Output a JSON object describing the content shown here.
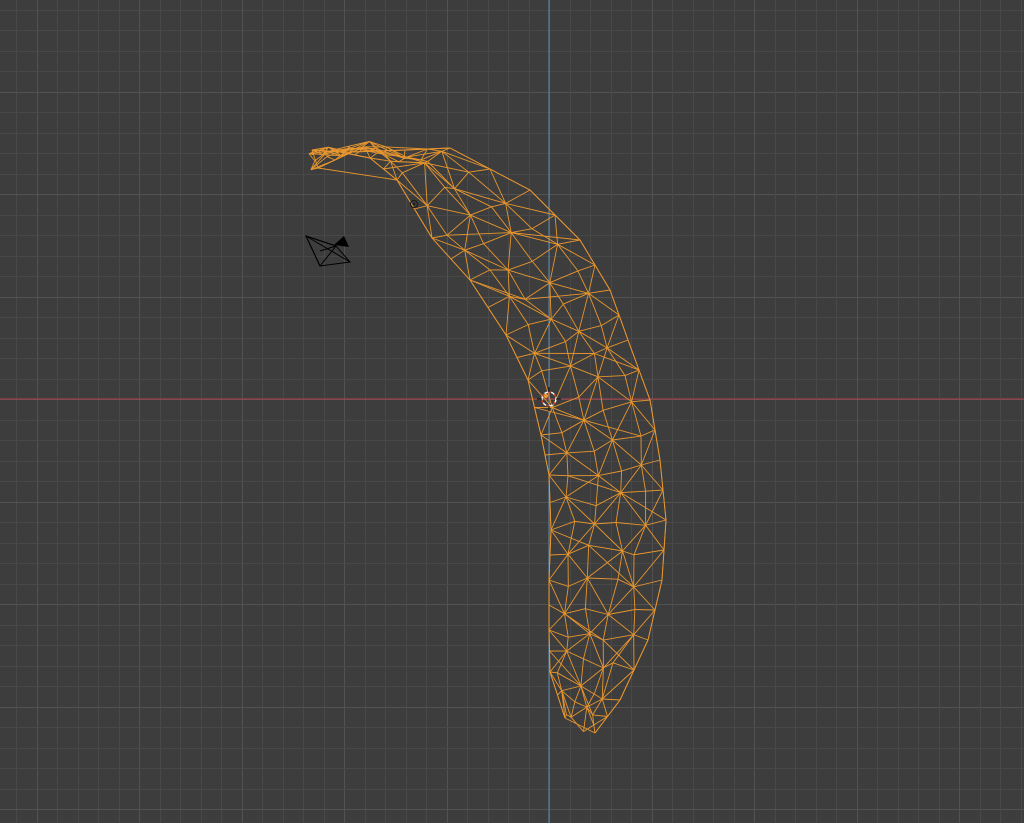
{
  "viewport": {
    "mode": "wireframe",
    "view": "orthographic"
  },
  "colors": {
    "background": "#3d3d3d",
    "grid_minor": "#484848",
    "grid_major": "#525252",
    "axis_x": "#b2404f",
    "axis_y": "#5a8ab0",
    "wire_selected": "#e8962e",
    "camera": "#000000",
    "light": "#1a1a1a",
    "origin": "#e8962e",
    "cursor_ring": "#ffffff",
    "cursor_dash": "#d44a3a"
  },
  "objects": {
    "mesh": "banana",
    "selected": true,
    "camera": "camera-icon",
    "light": "light-icon",
    "cursor": "3d-cursor-icon"
  }
}
